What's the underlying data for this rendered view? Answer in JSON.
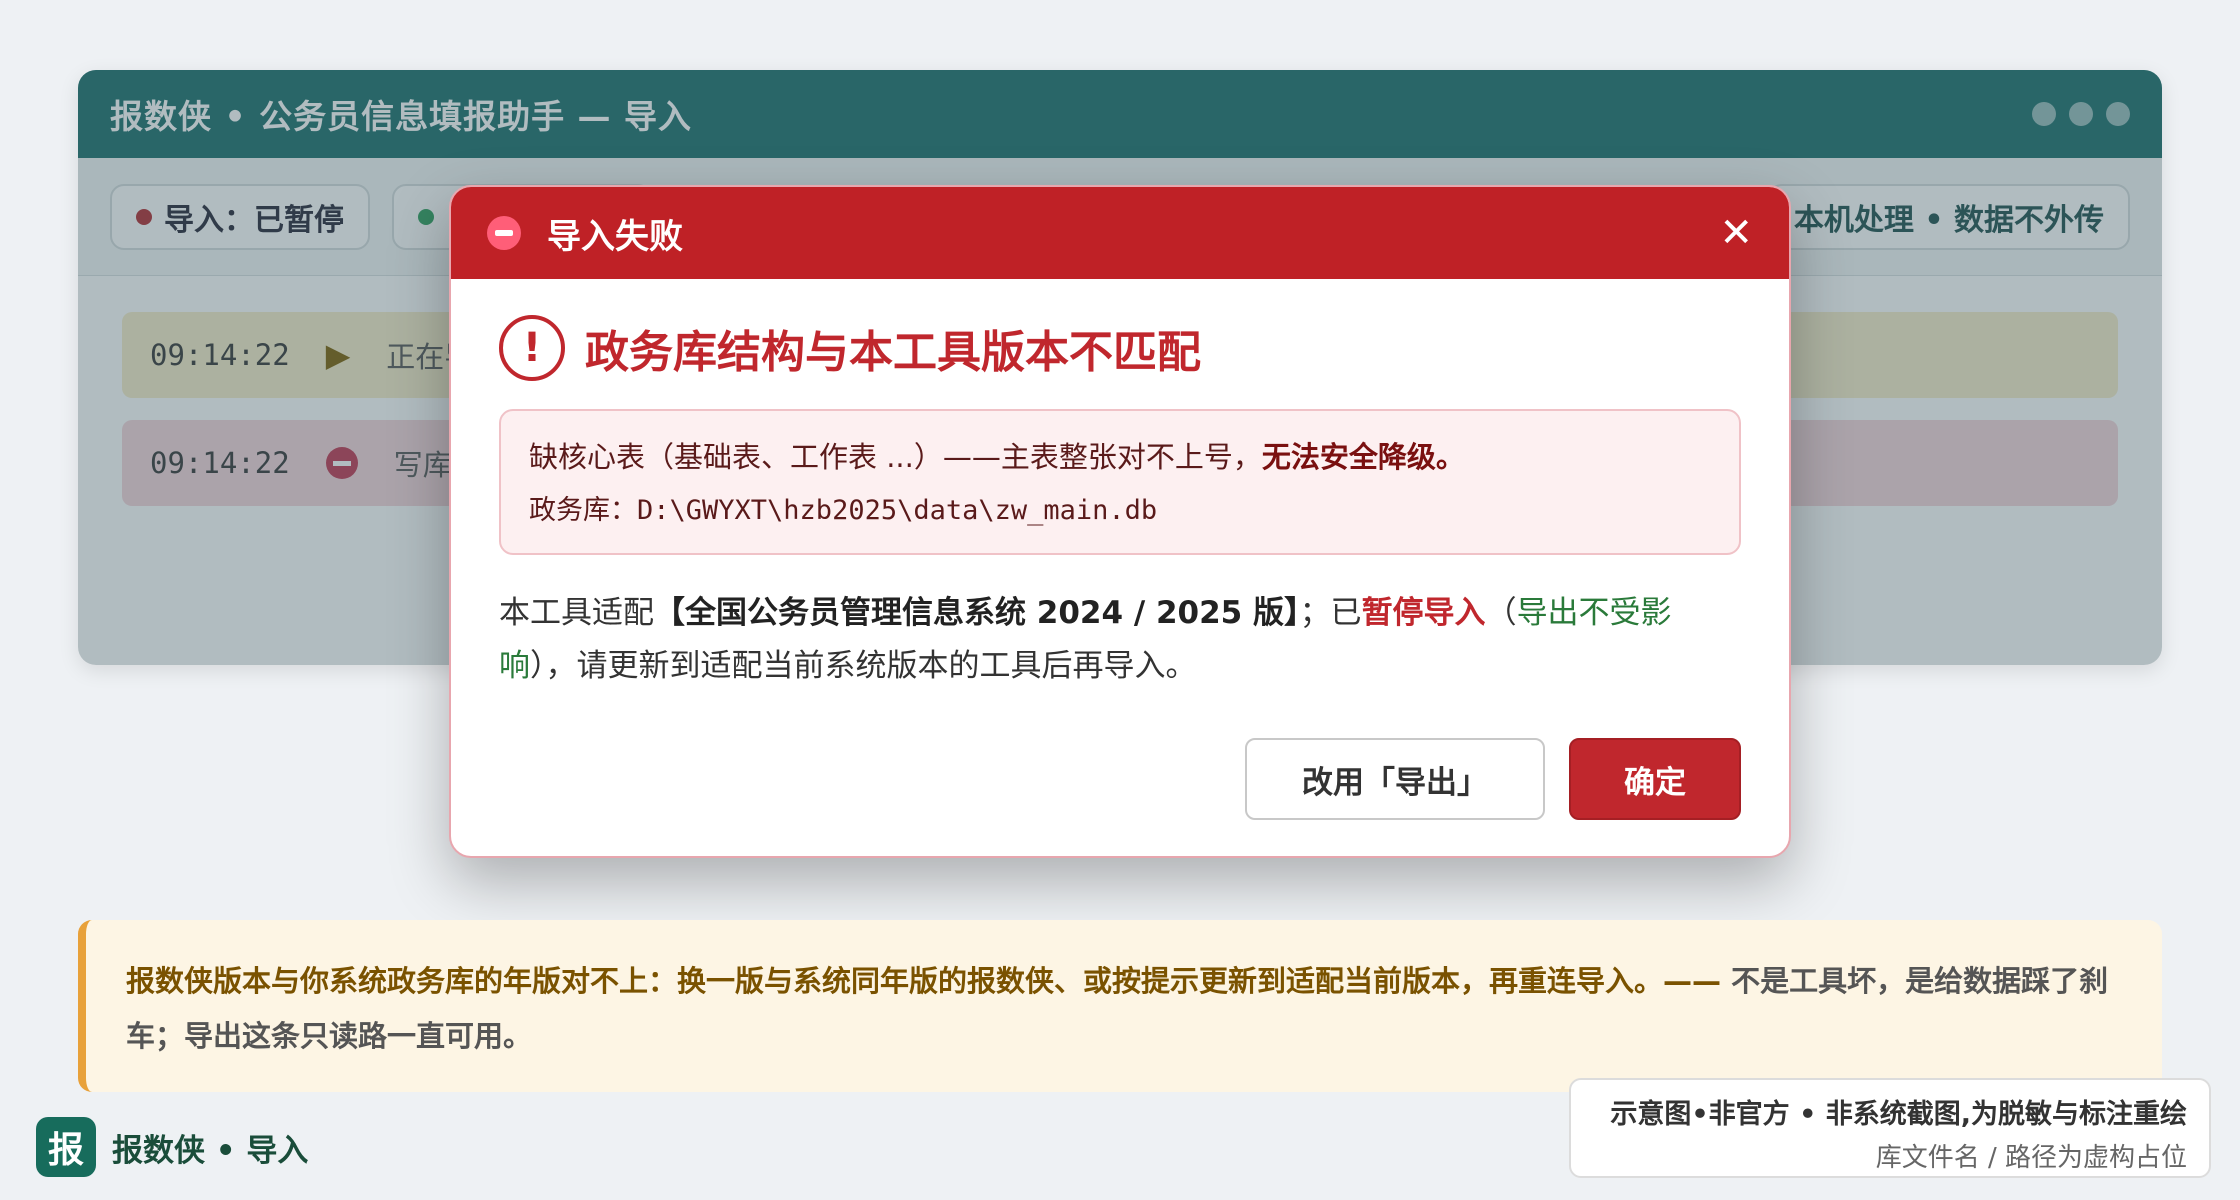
{
  "app": {
    "title": "报数侠 • 公务员信息填报助手 — 导入",
    "status_import": "导入：已暂停",
    "status_second": "",
    "local_notice": "本机处理 • 数据不外传"
  },
  "log": [
    {
      "time": "09:14:22",
      "text": "正在导"
    },
    {
      "time": "09:14:22",
      "text": "写库"
    }
  ],
  "dialog": {
    "title": "导入失败",
    "headline": "政务库结构与本工具版本不匹配",
    "error_reason": "缺核心表（基础表、工作表 ...）——主表整张对不上号，",
    "error_reason_bold": "无法安全降级。",
    "db_label": "政务库：",
    "db_path": "D:\\GWYXT\\hzb2025\\data\\zw_main.db",
    "explain_1": "本工具适配",
    "explain_system": "【全国公务员管理信息系统 2024 / 2025 版】",
    "explain_2": "；已",
    "explain_paused": "暂停导入",
    "explain_3": "（",
    "explain_export": "导出不受影响",
    "explain_4": "），请更新到适配当前系统版本的工具后再导入。",
    "btn_secondary": "改用「导出」",
    "btn_primary": "确定"
  },
  "tip": {
    "main": "报数侠版本与你系统政务库的年版对不上：换一版与系统同年版的报数侠、或按提示更新到适配当前版本，再重连导入。——",
    "sub": "不是工具坏，是给数据踩了刹车；导出这条只读路一直可用。"
  },
  "brand": {
    "logo_char": "报",
    "name": "报数侠 • 导入"
  },
  "disclaimer": {
    "line1": "示意图•非官方 • 非系统截图,为脱敏与标注重绘",
    "line2": "库文件名 / 路径为虚构占位"
  },
  "colors": {
    "titlebar": "#166c68",
    "danger": "#c0272d",
    "tip_accent": "#e8a13a",
    "status_red": "#c0272d",
    "status_green": "#2a9d5a"
  }
}
